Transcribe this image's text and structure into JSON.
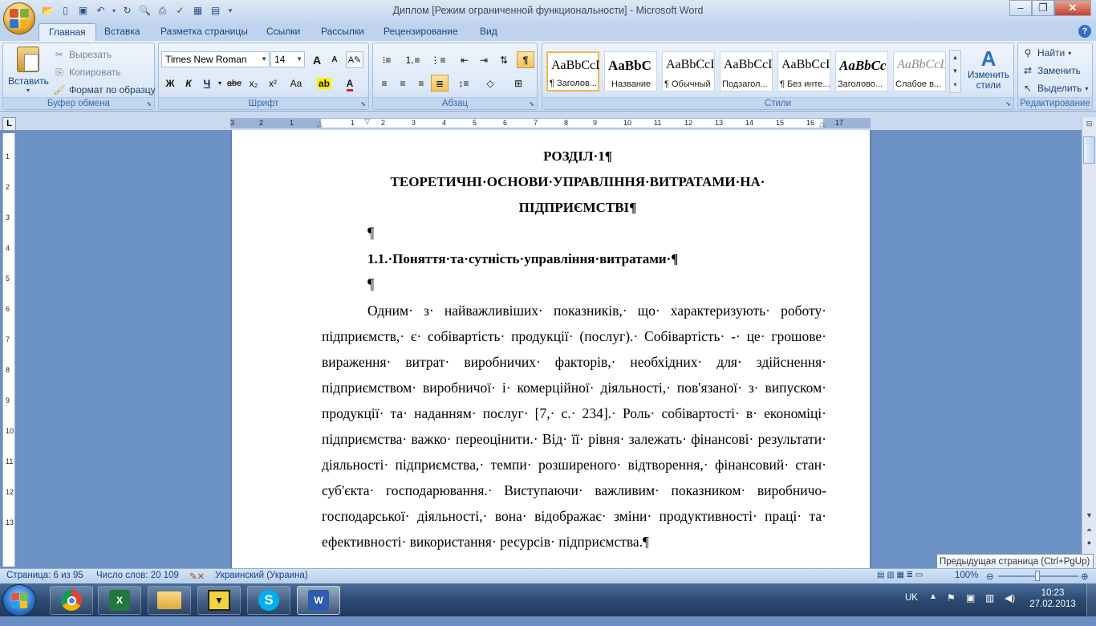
{
  "window": {
    "title": "Диплом [Режим ограниченной функциональности] - Microsoft Word",
    "controls": [
      "–",
      "❐",
      "✕"
    ]
  },
  "ribbon_tabs": [
    "Главная",
    "Вставка",
    "Разметка страницы",
    "Ссылки",
    "Рассылки",
    "Рецензирование",
    "Вид"
  ],
  "clipboard": {
    "paste": "Вставить",
    "cut": "Вырезать",
    "copy": "Копировать",
    "format_painter": "Формат по образцу",
    "label": "Буфер обмена"
  },
  "font": {
    "name": "Times New Roman",
    "size": "14",
    "label": "Шрифт",
    "bold": "Ж",
    "italic": "К",
    "underline": "Ч",
    "strike": "abe",
    "subscript": "x₂",
    "superscript": "x²",
    "case": "Aa",
    "grow": "A",
    "shrink": "A"
  },
  "paragraph": {
    "label": "Абзац",
    "pilcrow": "¶"
  },
  "styles": {
    "label": "Стили",
    "items": [
      {
        "sample": "AaBbCcDc",
        "name": "¶ Заголов..."
      },
      {
        "sample": "AaBbC",
        "name": "Название"
      },
      {
        "sample": "AaBbCcI",
        "name": "¶ Обычный"
      },
      {
        "sample": "AaBbCcDc",
        "name": "Подзагол..."
      },
      {
        "sample": "AaBbCcI",
        "name": "¶ Без инте..."
      },
      {
        "sample": "AaBbCc",
        "name": "Заголово..."
      },
      {
        "sample": "AaBbCcL",
        "name": "Слабое в..."
      }
    ],
    "change_styles": "Изменить стили"
  },
  "editing": {
    "find": "Найти",
    "replace": "Заменить",
    "select": "Выделить",
    "label": "Редактирование"
  },
  "ruler": {
    "tab_selector": "L",
    "h_numbers": [
      "3",
      "2",
      "1",
      "1",
      "2",
      "3",
      "4",
      "5",
      "6",
      "7",
      "8",
      "9",
      "10",
      "11",
      "12",
      "13",
      "14",
      "15",
      "16",
      "17"
    ],
    "v_numbers": [
      "1",
      "2",
      "3",
      "4",
      "5",
      "6",
      "7",
      "8",
      "9",
      "10",
      "11",
      "12",
      "13"
    ]
  },
  "document": {
    "chapter": "РОЗДІЛ·1¶",
    "title_line1": "ТЕОРЕТИЧНІ·ОСНОВИ·УПРАВЛІННЯ·ВИТРАТАМИ·НА·",
    "title_line2": "ПІДПРИЄМСТВІ¶",
    "empty1": "¶",
    "section": "1.1.·Поняття·та·сутність·управління·витратами·¶",
    "empty2": "¶",
    "lines": [
      "Одним· з· найважливіших· показників,· що· характеризують· роботу·",
      "підприємств,· є· собівартість· продукції· (послуг).· Собівартість· -· це· грошове·",
      "вираження· витрат· виробничих· факторів,· необхідних· для· здійснення·",
      "підприємством· виробничої· і· комерційної· діяльності,· пов'язаної· з· випуском·",
      "продукції· та· наданням· послуг· [7,· с.· 234].· Роль· собівартості· в· економіці·",
      "підприємства· важко· переоцінити.· Від· її· рівня· залежать· фінансові· результати·",
      "діяльності· підприємства,· темпи· розширеного· відтворення,· фінансовий· стан·",
      "суб'єкта· господарювання.· Виступаючи· важливим· показником· виробничо-",
      "господарської· діяльності,· вона· відображає· зміни· продуктивності· праці· та·",
      "ефективності· використання· ресурсів· підприємства.¶"
    ]
  },
  "status": {
    "page": "Страница: 6 из 95",
    "words": "Число слов: 20 109",
    "language": "Украинский (Украина)",
    "zoom": "100%"
  },
  "tooltip": "Предыдущая страница (Ctrl+PgUp)",
  "taskbar": {
    "lang": "UK",
    "time": "10:23",
    "date": "27.02.2013"
  }
}
